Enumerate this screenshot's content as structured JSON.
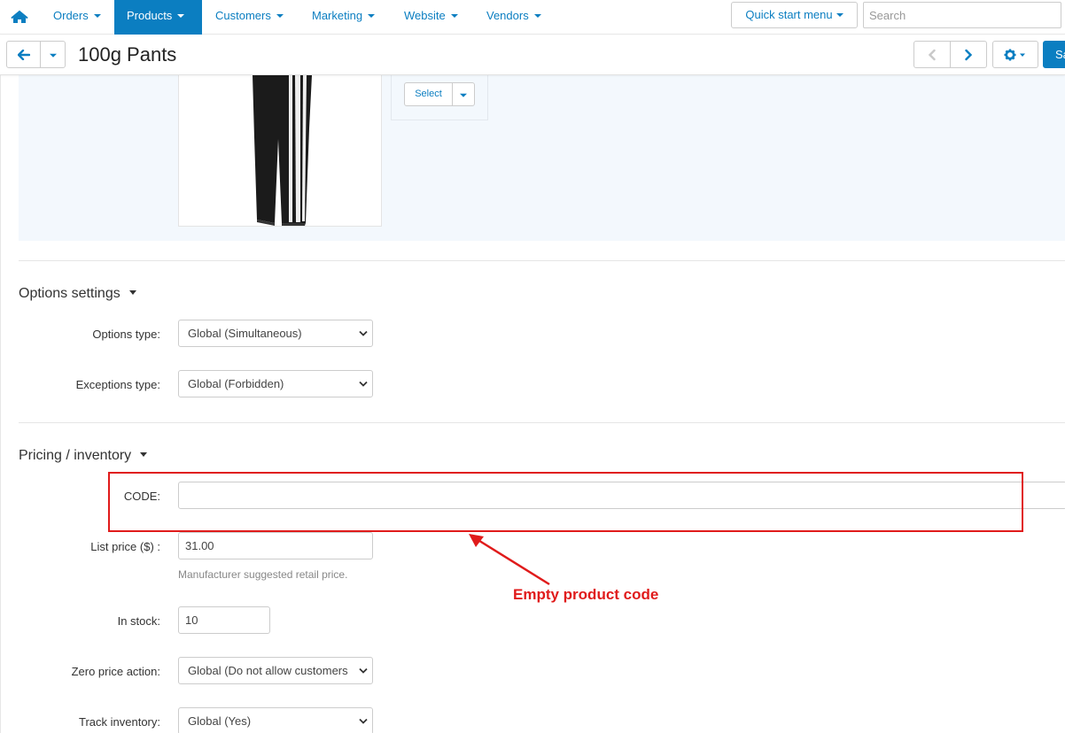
{
  "nav": {
    "items": [
      {
        "label": "Orders"
      },
      {
        "label": "Products"
      },
      {
        "label": "Customers"
      },
      {
        "label": "Marketing"
      },
      {
        "label": "Website"
      },
      {
        "label": "Vendors"
      }
    ],
    "active": "Products",
    "quick_start_label": "Quick start menu",
    "search_placeholder": "Search"
  },
  "header": {
    "title": "100g Pants",
    "save_label": "Save"
  },
  "image": {
    "select_label": "Select"
  },
  "options_settings": {
    "title": "Options settings",
    "options_type_label": "Options type:",
    "options_type_value": "Global (Simultaneous)",
    "exceptions_type_label": "Exceptions type:",
    "exceptions_type_value": "Global (Forbidden)"
  },
  "pricing": {
    "title": "Pricing / inventory",
    "code_label": "CODE:",
    "code_value": "",
    "list_price_label": "List price ($) :",
    "list_price_value": "31.00",
    "list_price_help": "Manufacturer suggested retail price.",
    "in_stock_label": "In stock:",
    "in_stock_value": "10",
    "zero_price_label": "Zero price action:",
    "zero_price_value": "Global (Do not allow customers",
    "track_inventory_label": "Track inventory:",
    "track_inventory_value": "Global (Yes)"
  },
  "annotation": {
    "text": "Empty product code"
  },
  "colors": {
    "accent": "#0b7ec1",
    "annotation": "#e01b1b",
    "panel": "#f3f8fd"
  },
  "icons": [
    "home-icon",
    "arrow-left-icon",
    "chevron-left-icon",
    "chevron-right-icon",
    "gear-icon",
    "pants-image"
  ]
}
